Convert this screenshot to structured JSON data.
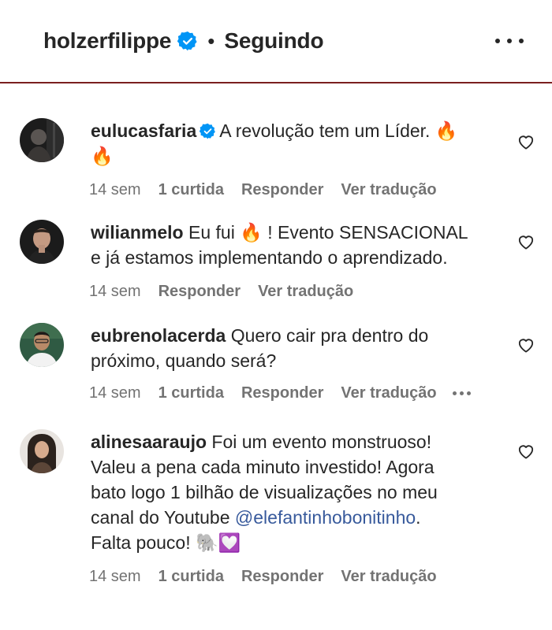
{
  "header": {
    "username": "holzerfilippe",
    "separator": "•",
    "following_label": "Seguindo",
    "verified_icon": "verified-badge-icon",
    "more_icon": "more-options-icon"
  },
  "comments": [
    {
      "username": "eulucasfaria",
      "verified": true,
      "text": "A revolução tem um Líder. 🔥",
      "text2": "🔥",
      "time": "14 sem",
      "likes": "1 curtida",
      "reply": "Responder",
      "translate": "Ver tradução"
    },
    {
      "username": "wilianmelo",
      "verified": false,
      "text": "Eu fui 🔥 ! Evento SENSACIONAL",
      "text2": "e já estamos implementando o aprendizado.",
      "time": "14 sem",
      "reply": "Responder",
      "translate": "Ver tradução"
    },
    {
      "username": "eubrenolacerda",
      "verified": false,
      "text": "Quero cair pra dentro do",
      "text2": "próximo, quando será?",
      "time": "14 sem",
      "likes": "1 curtida",
      "reply": "Responder",
      "translate": "Ver tradução"
    },
    {
      "username": "alinesaaraujo",
      "verified": false,
      "text": "Foi um evento monstruoso!",
      "text2": "Valeu a pena cada minuto investido! Agora",
      "text3": "bato logo 1 bilhão de visualizações no meu",
      "text4": "canal do Youtube",
      "mention": "@elefantinhobonitinho",
      "text4b": ".",
      "text5": "Falta pouco! 🐘💟",
      "time": "14 sem",
      "likes": "1 curtida",
      "reply": "Responder",
      "translate": "Ver tradução"
    }
  ],
  "colors": {
    "text": "#262626",
    "meta": "#737373",
    "mention": "#385a9c",
    "verified": "#0095f6",
    "header_rule": "#7a1f1f"
  }
}
